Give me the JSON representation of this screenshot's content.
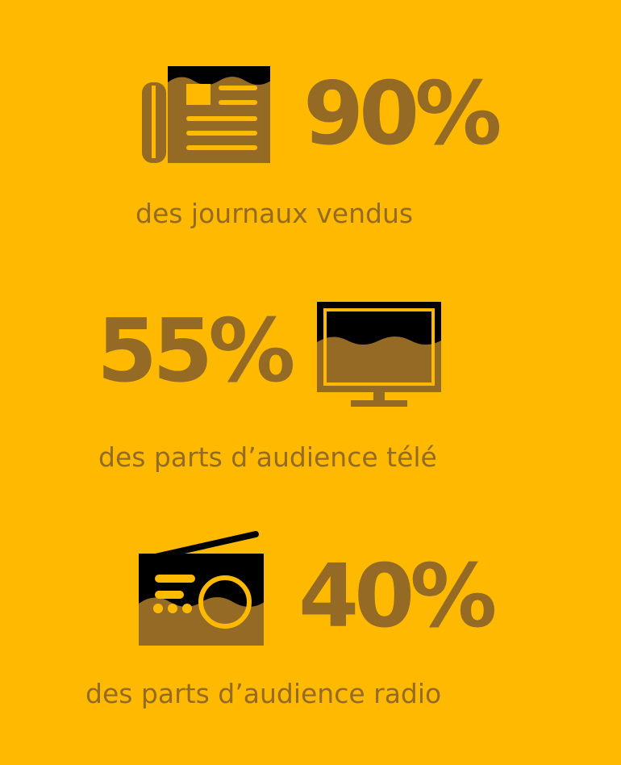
{
  "palette": {
    "background": "#FFBA00",
    "foreground": "#956A24",
    "icon_dark": "#000000"
  },
  "stats": [
    {
      "value": "90%",
      "caption": "des journaux vendus",
      "icon": "newspaper-icon"
    },
    {
      "value": "55%",
      "caption": "des parts d’audience télé",
      "icon": "television-icon"
    },
    {
      "value": "40%",
      "caption": "des parts d’audience radio",
      "icon": "radio-icon"
    }
  ]
}
